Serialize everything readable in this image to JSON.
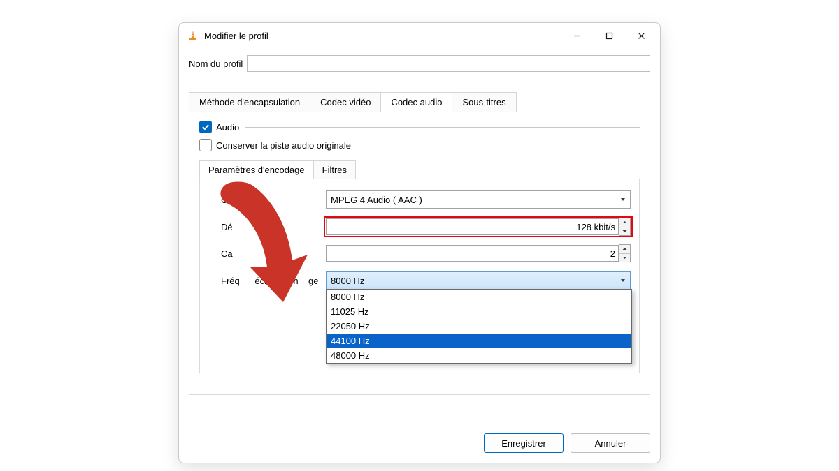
{
  "window": {
    "title": "Modifier le profil"
  },
  "profile_name": {
    "label": "Nom du profil",
    "value": ""
  },
  "tabs": {
    "encapsulation": "Méthode d'encapsulation",
    "video_codec": "Codec vidéo",
    "audio_codec": "Codec audio",
    "subtitles": "Sous-titres"
  },
  "audio_group": {
    "checkbox_label": "Audio",
    "keep_original_label": "Conserver la piste audio originale",
    "keep_original_checked": false
  },
  "subtabs": {
    "encoding": "Paramètres d'encodage",
    "filters": "Filtres"
  },
  "fields": {
    "codec_label_fragment": "Co",
    "codec_label_full_hidden": "c",
    "codec_value": "MPEG 4 Audio ( AAC )",
    "bitrate_label_fragment": "Dé",
    "bitrate_value": "128 kbit/s",
    "channels_label_fragment": "Ca",
    "channels_value": "2",
    "samplerate_label_start": "Fréq",
    "samplerate_label_mid": "échantillon",
    "samplerate_label_end": "ge",
    "samplerate_value": "8000 Hz"
  },
  "samplerate_options": [
    "8000 Hz",
    "11025 Hz",
    "22050 Hz",
    "44100 Hz",
    "48000 Hz"
  ],
  "samplerate_highlight_index": 3,
  "buttons": {
    "save": "Enregistrer",
    "cancel": "Annuler"
  }
}
